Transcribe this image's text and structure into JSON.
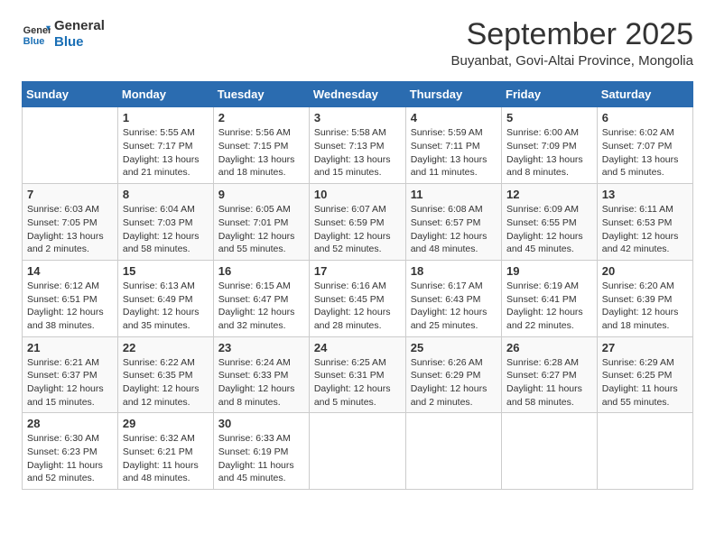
{
  "header": {
    "logo_line1": "General",
    "logo_line2": "Blue",
    "title": "September 2025",
    "subtitle": "Buyanbat, Govi-Altai Province, Mongolia"
  },
  "weekdays": [
    "Sunday",
    "Monday",
    "Tuesday",
    "Wednesday",
    "Thursday",
    "Friday",
    "Saturday"
  ],
  "weeks": [
    [
      {
        "day": "",
        "info": ""
      },
      {
        "day": "1",
        "info": "Sunrise: 5:55 AM\nSunset: 7:17 PM\nDaylight: 13 hours\nand 21 minutes."
      },
      {
        "day": "2",
        "info": "Sunrise: 5:56 AM\nSunset: 7:15 PM\nDaylight: 13 hours\nand 18 minutes."
      },
      {
        "day": "3",
        "info": "Sunrise: 5:58 AM\nSunset: 7:13 PM\nDaylight: 13 hours\nand 15 minutes."
      },
      {
        "day": "4",
        "info": "Sunrise: 5:59 AM\nSunset: 7:11 PM\nDaylight: 13 hours\nand 11 minutes."
      },
      {
        "day": "5",
        "info": "Sunrise: 6:00 AM\nSunset: 7:09 PM\nDaylight: 13 hours\nand 8 minutes."
      },
      {
        "day": "6",
        "info": "Sunrise: 6:02 AM\nSunset: 7:07 PM\nDaylight: 13 hours\nand 5 minutes."
      }
    ],
    [
      {
        "day": "7",
        "info": "Sunrise: 6:03 AM\nSunset: 7:05 PM\nDaylight: 13 hours\nand 2 minutes."
      },
      {
        "day": "8",
        "info": "Sunrise: 6:04 AM\nSunset: 7:03 PM\nDaylight: 12 hours\nand 58 minutes."
      },
      {
        "day": "9",
        "info": "Sunrise: 6:05 AM\nSunset: 7:01 PM\nDaylight: 12 hours\nand 55 minutes."
      },
      {
        "day": "10",
        "info": "Sunrise: 6:07 AM\nSunset: 6:59 PM\nDaylight: 12 hours\nand 52 minutes."
      },
      {
        "day": "11",
        "info": "Sunrise: 6:08 AM\nSunset: 6:57 PM\nDaylight: 12 hours\nand 48 minutes."
      },
      {
        "day": "12",
        "info": "Sunrise: 6:09 AM\nSunset: 6:55 PM\nDaylight: 12 hours\nand 45 minutes."
      },
      {
        "day": "13",
        "info": "Sunrise: 6:11 AM\nSunset: 6:53 PM\nDaylight: 12 hours\nand 42 minutes."
      }
    ],
    [
      {
        "day": "14",
        "info": "Sunrise: 6:12 AM\nSunset: 6:51 PM\nDaylight: 12 hours\nand 38 minutes."
      },
      {
        "day": "15",
        "info": "Sunrise: 6:13 AM\nSunset: 6:49 PM\nDaylight: 12 hours\nand 35 minutes."
      },
      {
        "day": "16",
        "info": "Sunrise: 6:15 AM\nSunset: 6:47 PM\nDaylight: 12 hours\nand 32 minutes."
      },
      {
        "day": "17",
        "info": "Sunrise: 6:16 AM\nSunset: 6:45 PM\nDaylight: 12 hours\nand 28 minutes."
      },
      {
        "day": "18",
        "info": "Sunrise: 6:17 AM\nSunset: 6:43 PM\nDaylight: 12 hours\nand 25 minutes."
      },
      {
        "day": "19",
        "info": "Sunrise: 6:19 AM\nSunset: 6:41 PM\nDaylight: 12 hours\nand 22 minutes."
      },
      {
        "day": "20",
        "info": "Sunrise: 6:20 AM\nSunset: 6:39 PM\nDaylight: 12 hours\nand 18 minutes."
      }
    ],
    [
      {
        "day": "21",
        "info": "Sunrise: 6:21 AM\nSunset: 6:37 PM\nDaylight: 12 hours\nand 15 minutes."
      },
      {
        "day": "22",
        "info": "Sunrise: 6:22 AM\nSunset: 6:35 PM\nDaylight: 12 hours\nand 12 minutes."
      },
      {
        "day": "23",
        "info": "Sunrise: 6:24 AM\nSunset: 6:33 PM\nDaylight: 12 hours\nand 8 minutes."
      },
      {
        "day": "24",
        "info": "Sunrise: 6:25 AM\nSunset: 6:31 PM\nDaylight: 12 hours\nand 5 minutes."
      },
      {
        "day": "25",
        "info": "Sunrise: 6:26 AM\nSunset: 6:29 PM\nDaylight: 12 hours\nand 2 minutes."
      },
      {
        "day": "26",
        "info": "Sunrise: 6:28 AM\nSunset: 6:27 PM\nDaylight: 11 hours\nand 58 minutes."
      },
      {
        "day": "27",
        "info": "Sunrise: 6:29 AM\nSunset: 6:25 PM\nDaylight: 11 hours\nand 55 minutes."
      }
    ],
    [
      {
        "day": "28",
        "info": "Sunrise: 6:30 AM\nSunset: 6:23 PM\nDaylight: 11 hours\nand 52 minutes."
      },
      {
        "day": "29",
        "info": "Sunrise: 6:32 AM\nSunset: 6:21 PM\nDaylight: 11 hours\nand 48 minutes."
      },
      {
        "day": "30",
        "info": "Sunrise: 6:33 AM\nSunset: 6:19 PM\nDaylight: 11 hours\nand 45 minutes."
      },
      {
        "day": "",
        "info": ""
      },
      {
        "day": "",
        "info": ""
      },
      {
        "day": "",
        "info": ""
      },
      {
        "day": "",
        "info": ""
      }
    ]
  ]
}
